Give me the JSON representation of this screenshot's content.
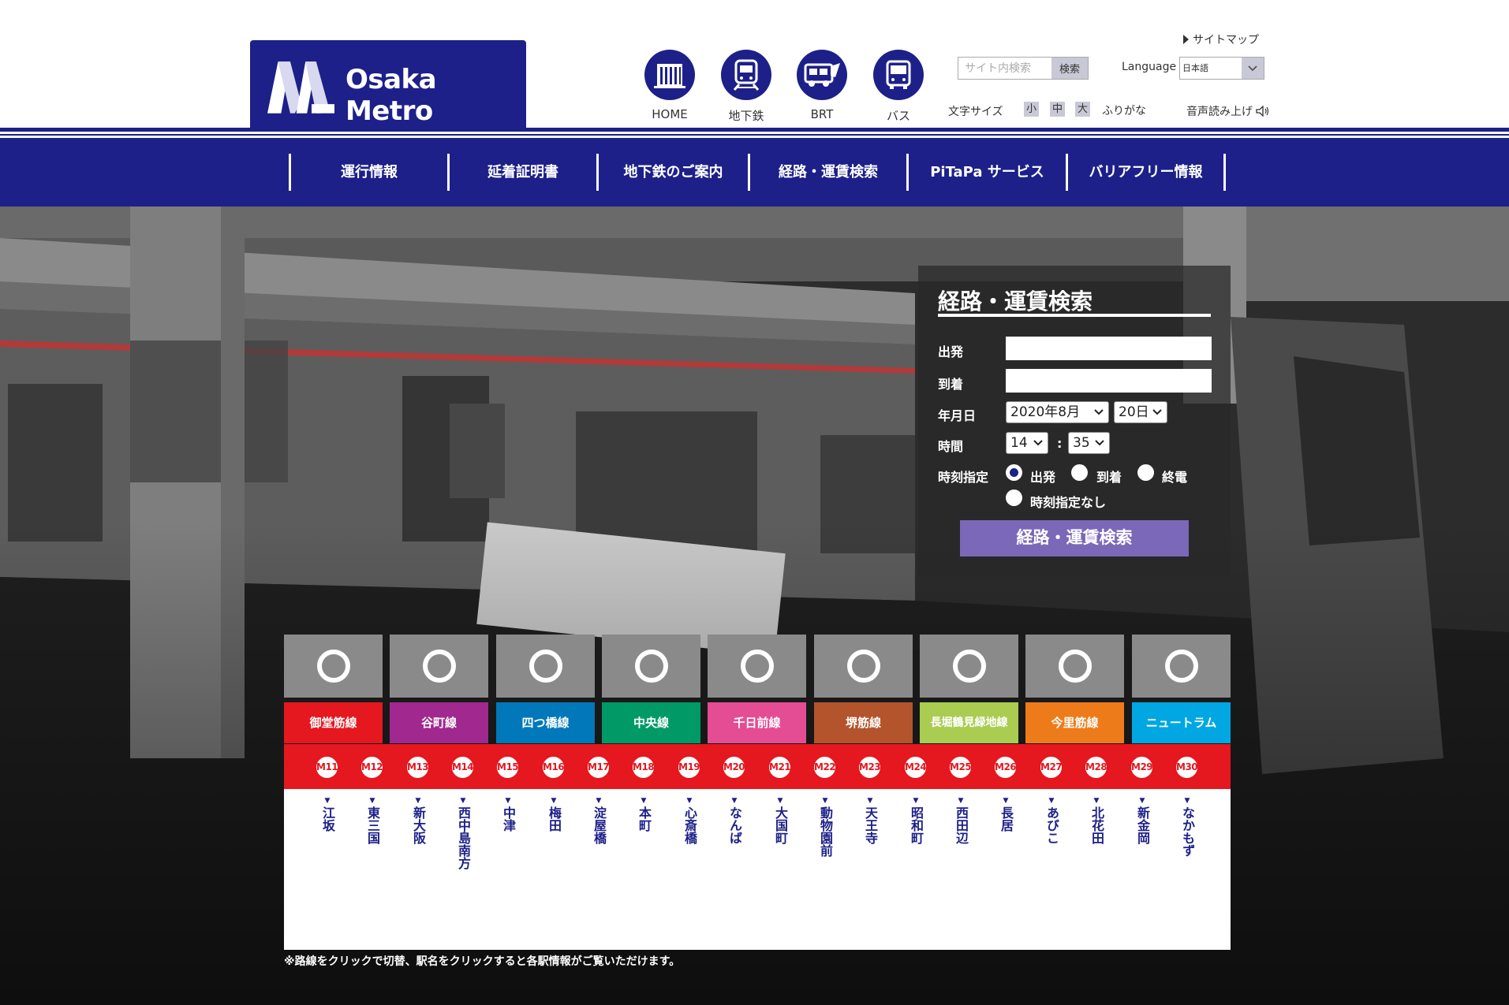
{
  "header": {
    "logo_text": "Osaka Metro",
    "sitemap": "サイトマップ",
    "icon_nav": [
      {
        "label": "HOME",
        "icon": "building-icon"
      },
      {
        "label": "地下鉄",
        "icon": "subway-train-icon"
      },
      {
        "label": "BRT",
        "icon": "brt-bus-icon"
      },
      {
        "label": "バス",
        "icon": "bus-icon"
      }
    ],
    "search_placeholder": "サイト内検索",
    "search_button": "検索",
    "language_label": "Language",
    "language_value": "日本語",
    "font_size_label": "文字サイズ",
    "font_sizes": [
      "小",
      "中",
      "大"
    ],
    "furigana": "ふりがな",
    "read_aloud": "音声読み上げ"
  },
  "global_nav": [
    "運行情報",
    "延着証明書",
    "地下鉄のご案内",
    "経路・運賃検索",
    "PiTaPa サービス",
    "バリアフリー情報"
  ],
  "route_search": {
    "title": "経路・運賃検索",
    "departure_label": "出発",
    "arrival_label": "到着",
    "date_label": "年月日",
    "year_month": "2020年8月",
    "day": "20日",
    "time_label": "時間",
    "hour": "14",
    "time_sep": ":",
    "minute": "35",
    "time_spec_label": "時刻指定",
    "options": [
      "出発",
      "到着",
      "終電",
      "時刻指定なし"
    ],
    "selected_option": "出発",
    "submit": "経路・運賃検索"
  },
  "lines": [
    {
      "name": "御堂筋線",
      "color": "#e5171f"
    },
    {
      "name": "谷町線",
      "color": "#a0288e"
    },
    {
      "name": "四つ橋線",
      "color": "#0078ba"
    },
    {
      "name": "中央線",
      "color": "#019a66"
    },
    {
      "name": "千日前線",
      "color": "#e44d93"
    },
    {
      "name": "堺筋線",
      "color": "#b3542c"
    },
    {
      "name": "長堀鶴見緑地線",
      "color": "#a9cc51"
    },
    {
      "name": "今里筋線",
      "color": "#ee7b1a"
    },
    {
      "name": "ニュートラム",
      "color": "#00a7e3"
    }
  ],
  "stations": [
    {
      "code": "M11",
      "name": "江坂"
    },
    {
      "code": "M12",
      "name": "東三国"
    },
    {
      "code": "M13",
      "name": "新大阪"
    },
    {
      "code": "M14",
      "name": "西中島南方"
    },
    {
      "code": "M15",
      "name": "中津"
    },
    {
      "code": "M16",
      "name": "梅田"
    },
    {
      "code": "M17",
      "name": "淀屋橋"
    },
    {
      "code": "M18",
      "name": "本町"
    },
    {
      "code": "M19",
      "name": "心斎橋"
    },
    {
      "code": "M20",
      "name": "なんば"
    },
    {
      "code": "M21",
      "name": "大国町"
    },
    {
      "code": "M22",
      "name": "動物園前"
    },
    {
      "code": "M23",
      "name": "天王寺"
    },
    {
      "code": "M24",
      "name": "昭和町"
    },
    {
      "code": "M25",
      "name": "西田辺"
    },
    {
      "code": "M26",
      "name": "長居"
    },
    {
      "code": "M27",
      "name": "あびこ"
    },
    {
      "code": "M28",
      "name": "北花田"
    },
    {
      "code": "M29",
      "name": "新金岡"
    },
    {
      "code": "M30",
      "name": "なかもず"
    }
  ],
  "station_arrow": "▼",
  "note": "※路線をクリックで切替、駅名をクリックすると各駅情報がご覧いただけます。"
}
